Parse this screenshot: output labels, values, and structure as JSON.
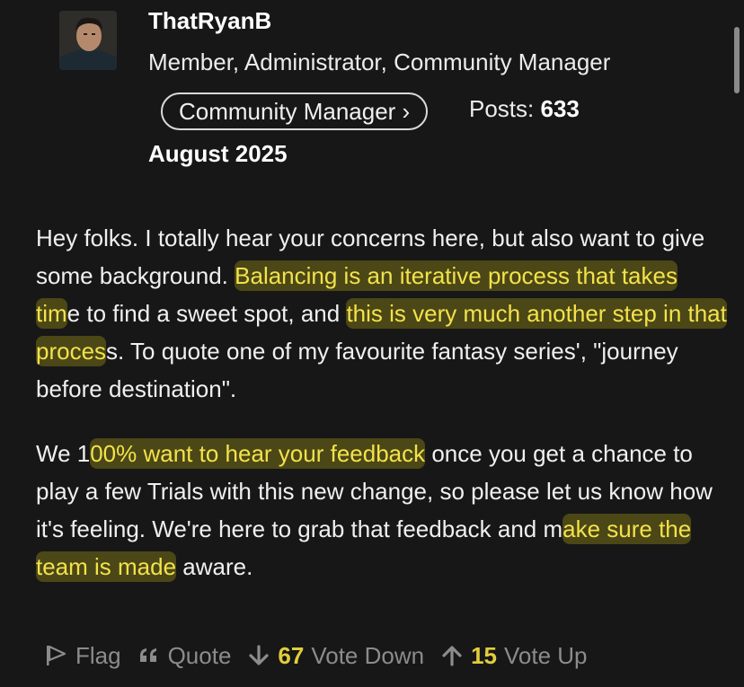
{
  "author": {
    "username": "ThatRyanB",
    "roles": "Member, Administrator, Community Manager",
    "role_badge": "Community Manager ›",
    "posts_label": "Posts: ",
    "posts_count": "633",
    "join_date": "August 2025"
  },
  "post": {
    "p1": {
      "a": "Hey folks. I totally hear your concerns here, but also want to give some background. ",
      "hl1": "Balancing is an iterative process that takes tim",
      "b": "e to find a sweet spot, and ",
      "hl2": "this is very much another step in that proces",
      "c": "s. To quote one of my favourite fantasy series', \"journey before destination\"."
    },
    "p2": {
      "a": "We 1",
      "hl1": "00% want to hear your feedback",
      "b": " once you get a chance to play a few Trials with this new change, so please let us know how it's feeling. We're here to grab that feedback and m",
      "hl2": "ake sure the team is made",
      "c": " aware."
    }
  },
  "actions": {
    "flag_label": "Flag",
    "quote_label": "Quote",
    "vote_down_count": "67",
    "vote_down_label": "Vote Down",
    "vote_up_count": "15",
    "vote_up_label": "Vote Up"
  },
  "icons": {
    "flag": "flag-icon",
    "quote": "quote-icon",
    "vote_down": "arrow-down-icon",
    "vote_up": "arrow-up-icon"
  },
  "colors": {
    "background": "#171717",
    "highlight_text": "#f3e24b",
    "vote_count": "#e3cd3a",
    "muted": "#8c8c8c"
  }
}
